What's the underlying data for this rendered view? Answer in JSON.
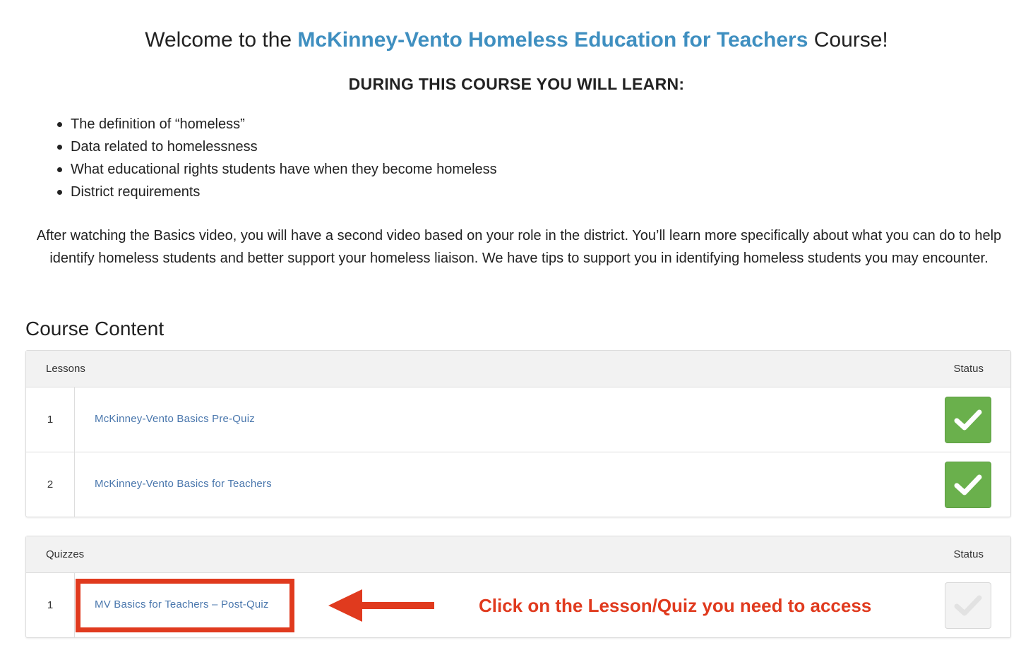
{
  "header": {
    "welcome_prefix": "Welcome to the ",
    "course_name": "McKinney-Vento Homeless Education for Teachers",
    "welcome_suffix": " Course!",
    "learn_heading": "DURING THIS COURSE YOU WILL LEARN:"
  },
  "learn_items": [
    "The definition of “homeless”",
    "Data related to homelessness",
    "What educational rights students have when they become homeless",
    "District requirements"
  ],
  "intro_text": "After watching the Basics video, you will have a second video based on your role in the district. You’ll learn more specifically about what you can do to help identify homeless students and better support your homeless liaison. We have tips to support you in identifying homeless students you may encounter.",
  "course_content": {
    "title": "Course Content",
    "lessons": {
      "header_label": "Lessons",
      "status_label": "Status",
      "rows": [
        {
          "num": "1",
          "title": "McKinney-Vento Basics Pre-Quiz",
          "status": "complete"
        },
        {
          "num": "2",
          "title": "McKinney-Vento Basics for Teachers",
          "status": "complete"
        }
      ]
    },
    "quizzes": {
      "header_label": "Quizzes",
      "status_label": "Status",
      "rows": [
        {
          "num": "1",
          "title": "MV Basics for Teachers – Post-Quiz",
          "status": "incomplete"
        }
      ]
    }
  },
  "annotation": {
    "callout_text": "Click on the Lesson/Quiz you need to access"
  },
  "colors": {
    "accent_link": "#4a77ad",
    "course_name": "#3f8fc0",
    "status_complete": "#6ab04c",
    "annotation_red": "#e03a1e"
  }
}
